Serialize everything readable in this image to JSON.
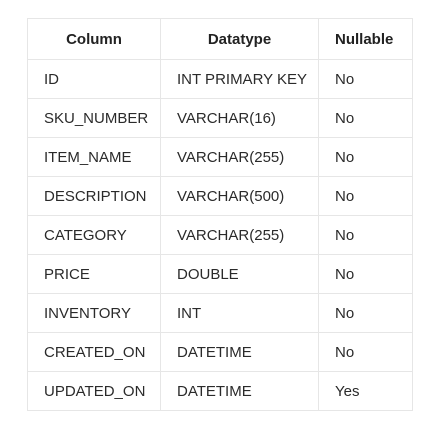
{
  "table": {
    "headers": [
      "Column",
      "Datatype",
      "Nullable"
    ],
    "rows": [
      [
        "ID",
        "INT PRIMARY KEY",
        "No"
      ],
      [
        "SKU_NUMBER",
        "VARCHAR(16)",
        "No"
      ],
      [
        "ITEM_NAME",
        "VARCHAR(255)",
        "No"
      ],
      [
        "DESCRIPTION",
        "VARCHAR(500)",
        "No"
      ],
      [
        "CATEGORY",
        "VARCHAR(255)",
        "No"
      ],
      [
        "PRICE",
        "DOUBLE",
        "No"
      ],
      [
        "INVENTORY",
        "INT",
        "No"
      ],
      [
        "CREATED_ON",
        "DATETIME",
        "No"
      ],
      [
        "UPDATED_ON",
        "DATETIME",
        "Yes"
      ]
    ]
  },
  "colors": {
    "border": "#e6e6e6",
    "text": "#2a2a2a",
    "background": "#ffffff"
  }
}
